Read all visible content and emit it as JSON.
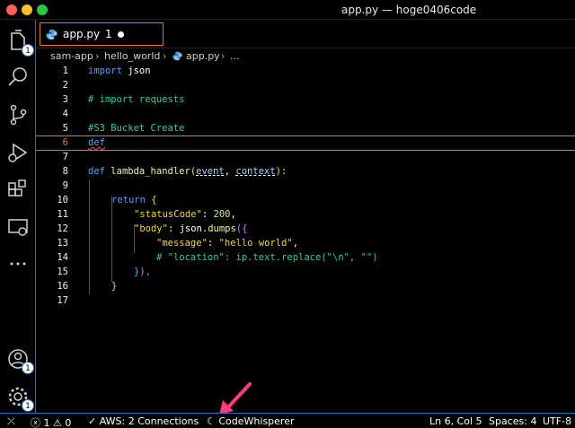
{
  "window": {
    "title": "app.py — hoge0406code"
  },
  "activity": {
    "explorer_badge": "1",
    "accounts_badge": "1",
    "settings_badge": "1"
  },
  "tab": {
    "name": "app.py",
    "problems": "1"
  },
  "breadcrumb": [
    "sam-app",
    "hello_world",
    "app.py",
    "..."
  ],
  "code": {
    "line_numbers": [
      "1",
      "2",
      "3",
      "4",
      "5",
      "6",
      "7",
      "8",
      "9",
      "10",
      "11",
      "12",
      "13",
      "14",
      "15",
      "16",
      "17"
    ],
    "l1_kw": "import",
    "l1_rest": " json",
    "l3": "# import requests",
    "l5": "#S3 Bucket Create",
    "l6": "def",
    "l8_kw": "def",
    "l8_fn": "lambda_handler",
    "l8_p1": "event",
    "l8_sep": ", ",
    "l8_p2": "context",
    "l8_end": "):",
    "l10_kw": "return",
    "l10_br": " {",
    "l11_key": "\"statusCode\"",
    "l11_sep": ": ",
    "l11_val": "200",
    "l11_end": ",",
    "l12_key": "\"body\"",
    "l12_sep": ": json.",
    "l12_fn": "dumps",
    "l12_br": "({",
    "l13_key": "\"message\"",
    "l13_sep": ": ",
    "l13_val": "\"hello world\"",
    "l13_end": ",",
    "l14": "# \"location\": ip.text.replace(\"\\n\", \"\")",
    "l15_br": "}",
    "l15_end": "),",
    "l16_br": "}"
  },
  "status": {
    "errors": "1",
    "warnings": "0",
    "aws": "AWS: 2 Connections",
    "codewhisperer": "CodeWhisperer",
    "position": "Ln 6, Col 5",
    "spaces": "Spaces: 4",
    "encoding": "UTF-8"
  },
  "colors": {
    "accent": "#e8742c",
    "border_blue": "#2a6fb8",
    "arrow": "#ff3d7f"
  }
}
